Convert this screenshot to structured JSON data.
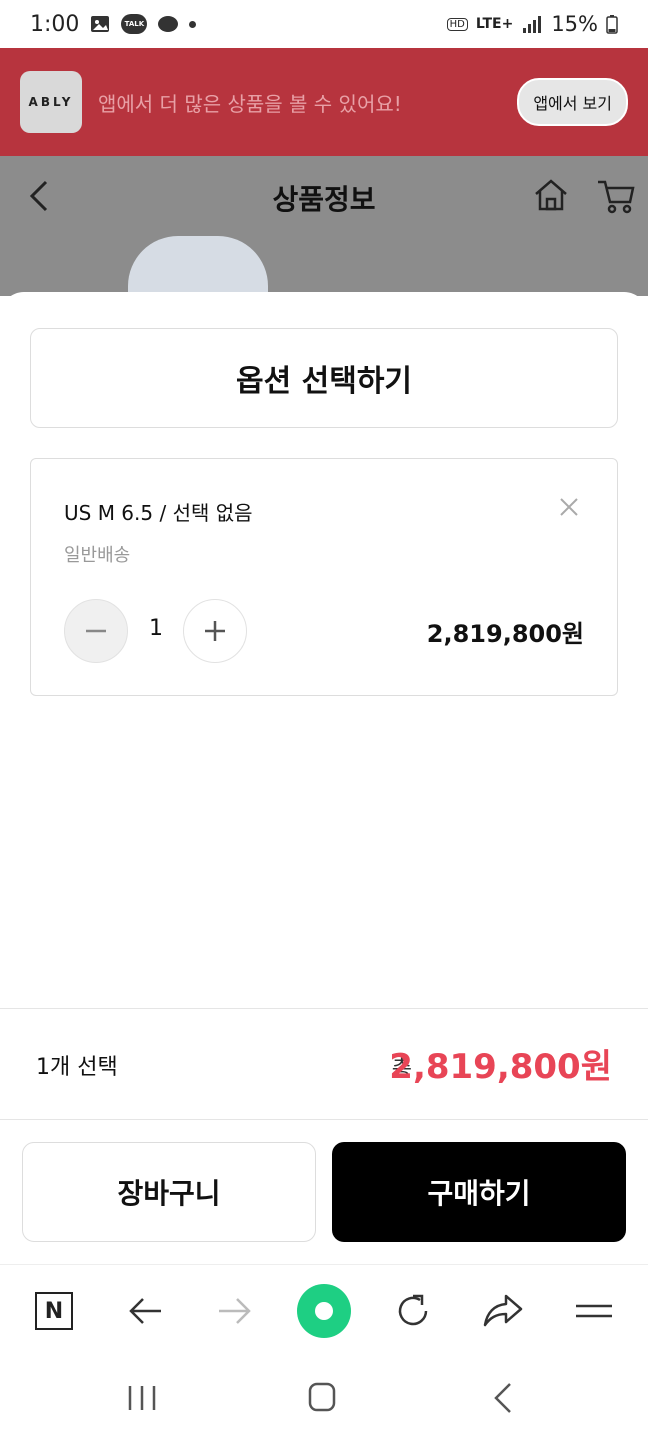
{
  "status": {
    "time": "1:00",
    "network": "LTE+",
    "battery": "15%",
    "hd": "HD",
    "talk": "TALK"
  },
  "banner": {
    "logo": "ABLY",
    "text": "앱에서 더 많은 상품을 볼 수 있어요!",
    "button": "앱에서 보기",
    "bg_color": "#b7343e"
  },
  "header": {
    "title": "상품정보"
  },
  "sheet": {
    "option_select_label": "옵션 선택하기",
    "option": {
      "name": "US M 6.5 / 선택 없음",
      "shipping": "일반배송",
      "quantity": "1",
      "price": "2,819,800원"
    },
    "summary": {
      "count_text": "1개 선택",
      "total_label": "총",
      "total_price": "2,819,800원"
    },
    "cart_button": "장바구니",
    "buy_button": "구매하기",
    "accent_color": "#e84556"
  },
  "browser_toolbar": {
    "items": [
      "n-home-icon",
      "back-arrow-icon",
      "forward-arrow-icon",
      "green-dot-icon",
      "refresh-icon",
      "share-icon",
      "menu-icon"
    ]
  },
  "system_nav": {
    "items": [
      "recents-icon",
      "home-icon",
      "back-icon"
    ]
  }
}
